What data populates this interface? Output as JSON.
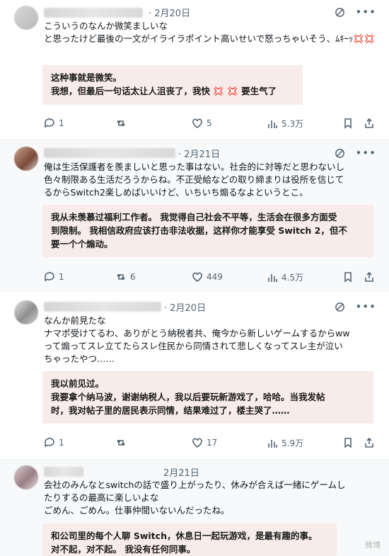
{
  "tweets": [
    {
      "date": "· 2月20日",
      "text": "こういうのなんか微笑ましいな\nと思ったけど最後の一文がイライラポイント高いせいで怒っちゃいそう、ﾑｷｰｯ💢💢",
      "translation": "这种事就是微笑。\n我想，但最后一句话太让人沮丧了，我快 💢 💢 要生气了",
      "replies": "1",
      "retweets": "",
      "likes": "5",
      "views": "5.3万"
    },
    {
      "date": "· 2月21日",
      "text": "俺は生活保護者を羨ましいと思った事はない。社会的に対等だと思わないし\n色々制限ある生活だろうからね。不正受給などの取り締まりは役所を信じて\nるからSwitch2楽しめばいいけど、いちいち煽るなよというとこ。",
      "translation": "我从未羡慕过福利工作者。 我觉得自己社会不平等，生活会在很多方面受\n到限制。 我相信政府应该打击非法收据，这样你才能享受 Switch 2，但不\n要一个个煽动。",
      "replies": "1",
      "retweets": "6",
      "likes": "449",
      "views": "4.5万"
    },
    {
      "date": "· 2月20日",
      "text": "なんか前見たな\nナマポ受けてるわ、ありがとう納税者共、俺今から新しいゲームするからww\nって煽ってスレ立てたらスレ住民から同情されて悲しくなってスレ主が泣い\nちゃったやつ……",
      "translation": "我以前见过。\n我要拿个纳马波，谢谢纳税人，我以后要玩新游戏了，哈哈。当我发帖\n时，我对帖子里的居民表示同情，结果难过了，楼主哭了……",
      "replies": "1",
      "retweets": "",
      "likes": "17",
      "views": "5.9万"
    },
    {
      "date": "2月21日",
      "text": "会社のみんなとswitchの話で盛り上がったり、休みが合えば一緒にゲームし\nたりするの最高に楽しいよな\nごめん、ごめん。仕事仲間いないんだったね。",
      "translation": "和公司里的每个人聊 Switch，休息日一起玩游戏，是最有趣的事。\n对不起，对不起。 我没有任何同事。",
      "replies": "",
      "retweets": "",
      "likes": "",
      "views": ""
    }
  ],
  "watermark": "微博"
}
